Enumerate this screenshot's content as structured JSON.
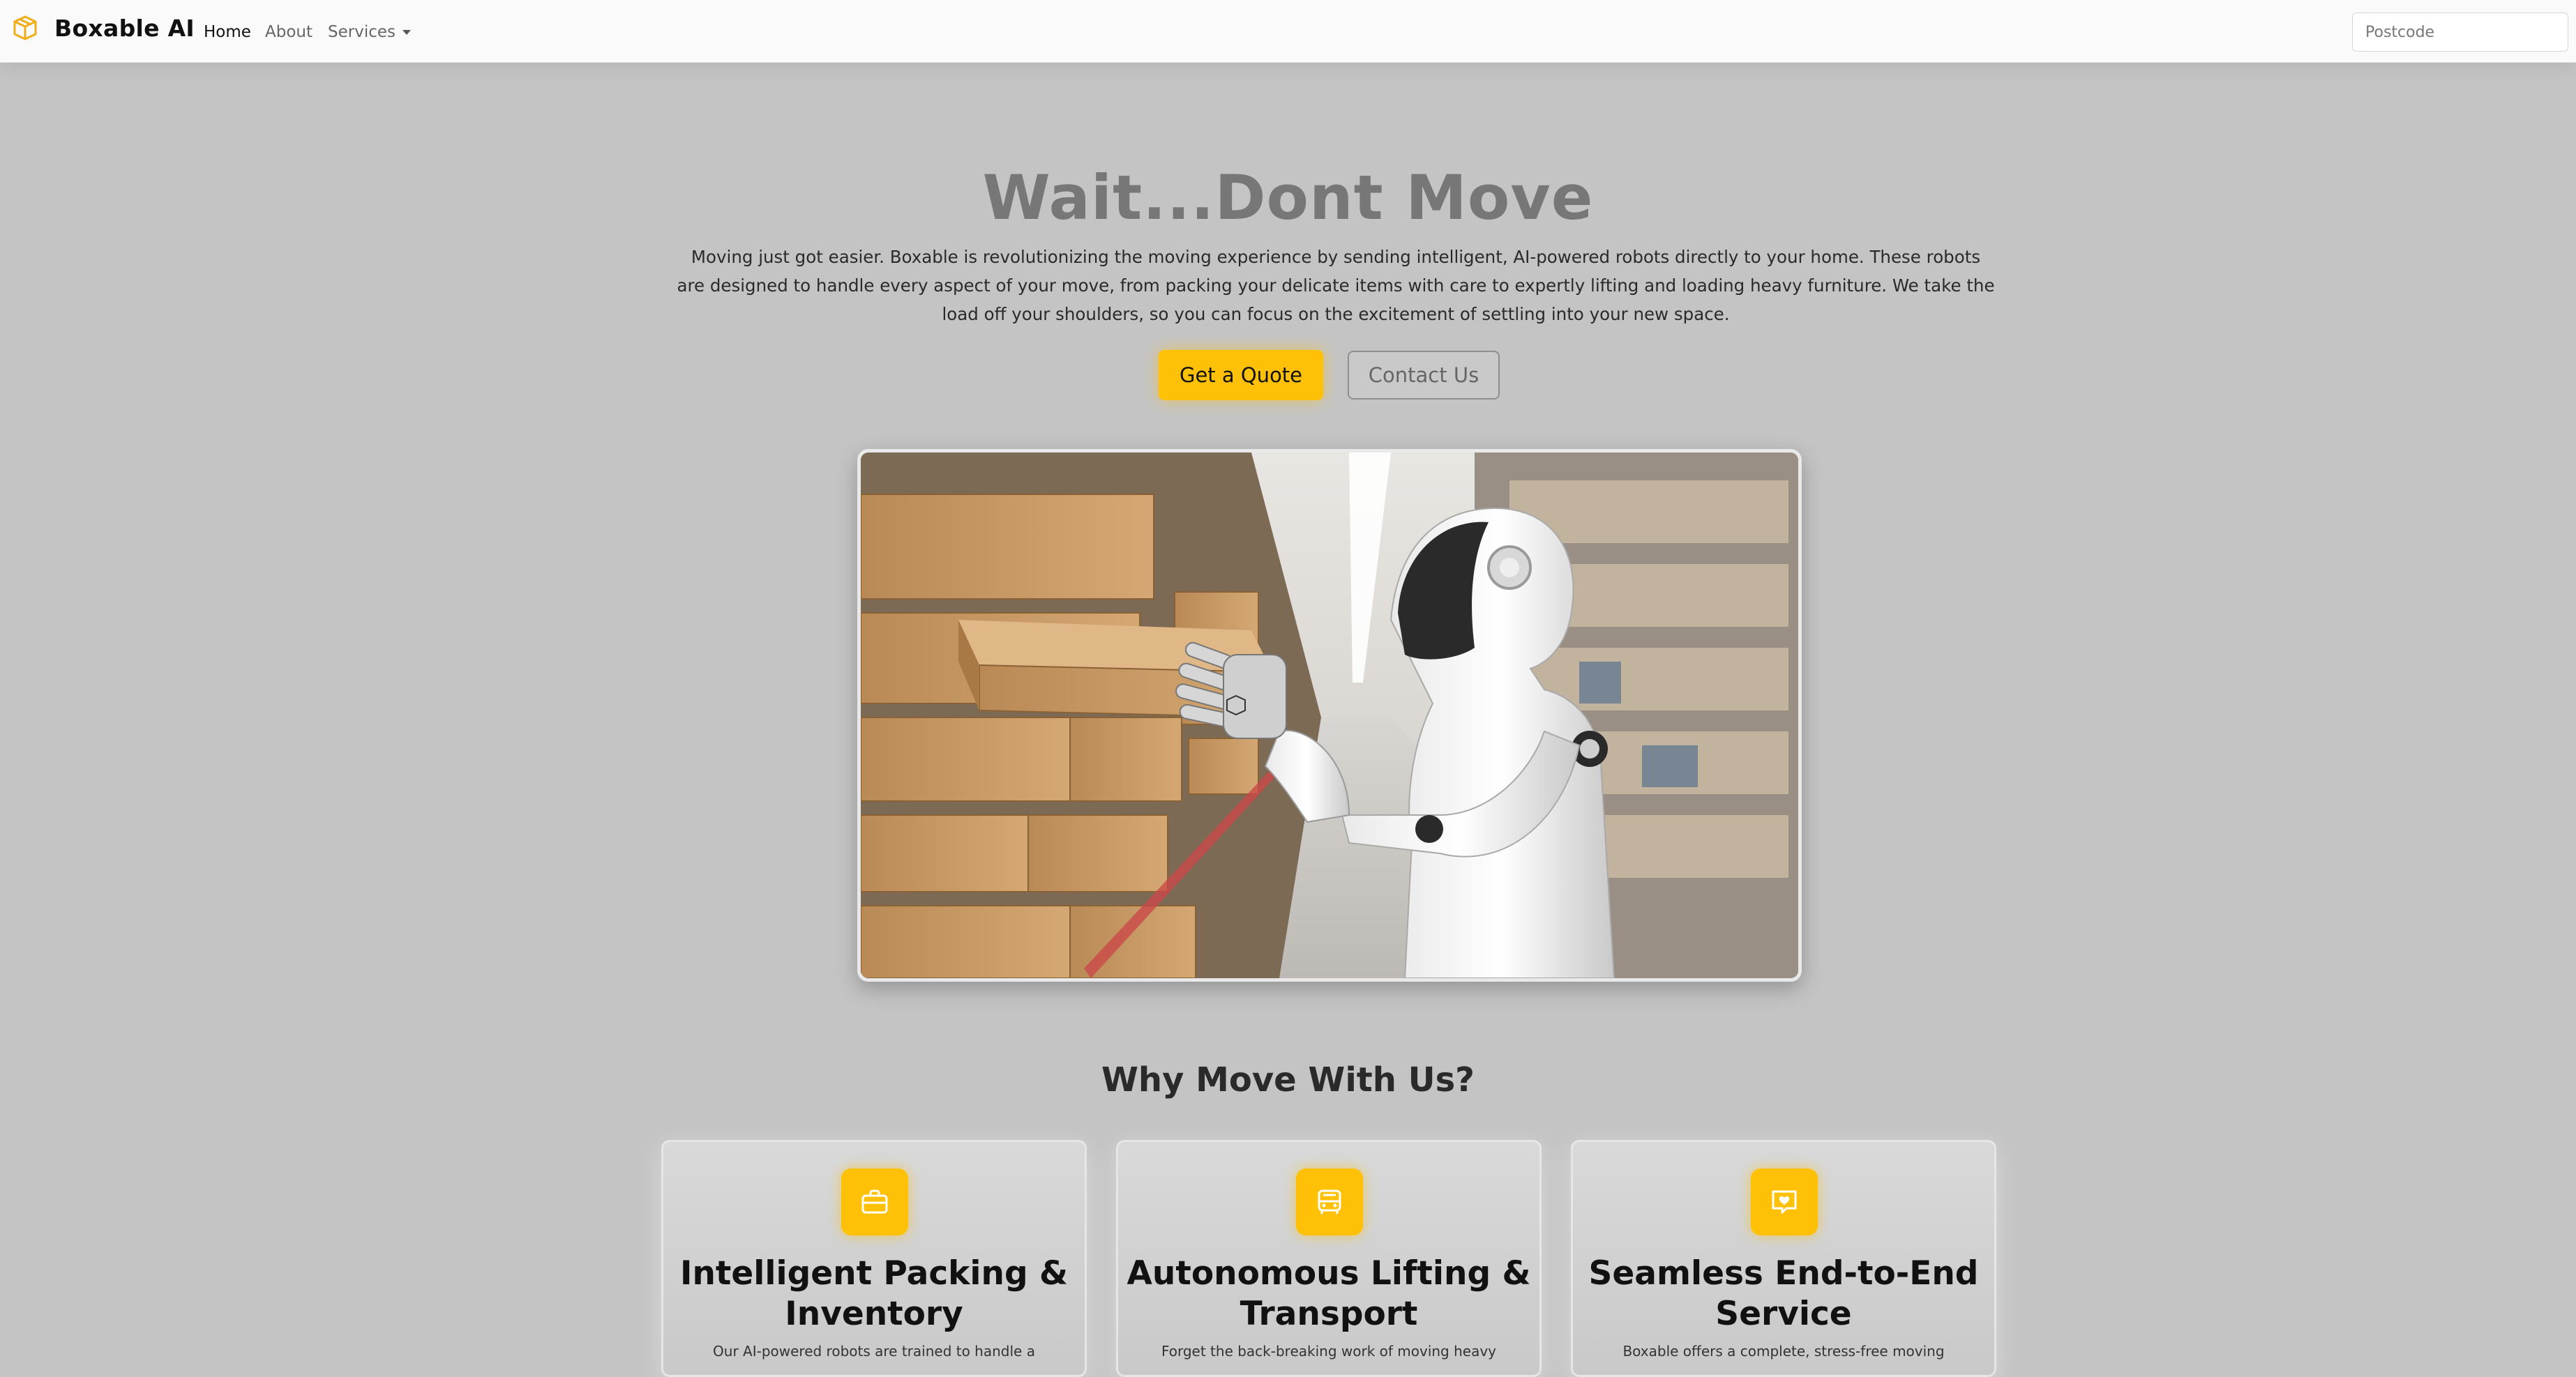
{
  "nav": {
    "brand": "Boxable AI",
    "links": [
      {
        "label": "Home",
        "active": true
      },
      {
        "label": "About",
        "active": false
      },
      {
        "label": "Services",
        "active": false
      }
    ],
    "postcode_placeholder": "Postcode",
    "brand_icon": "box-icon"
  },
  "hero": {
    "title": "Wait...Dont Move",
    "description": "Moving just got easier. Boxable is revolutionizing the moving experience by sending intelligent, AI-powered robots directly to your home. These robots are designed to handle every aspect of your move, from packing your delicate items with care to expertly lifting and loading heavy furniture. We take the load off your shoulders, so you can focus on the excitement of settling into your new space.",
    "primary_button": "Get a Quote",
    "secondary_button": "Contact Us"
  },
  "why": {
    "title": "Why Move With Us?",
    "cards": [
      {
        "icon": "briefcase-icon",
        "title": "Intelligent Packing & Inventory",
        "text": "Our AI-powered robots are trained to handle a"
      },
      {
        "icon": "truck-icon",
        "title": "Autonomous Lifting & Transport",
        "text": "Forget the back-breaking work of moving heavy"
      },
      {
        "icon": "heart-chat-icon",
        "title": "Seamless End-to-End Service",
        "text": "Boxable offers a complete, stress-free moving"
      }
    ]
  },
  "colors": {
    "accent": "#ffc107",
    "overlay": "#c4c4c4"
  }
}
